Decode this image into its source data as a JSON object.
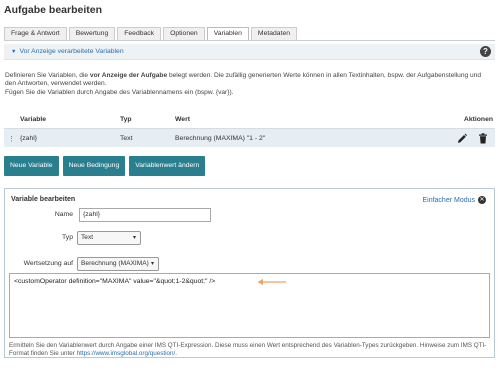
{
  "page": {
    "title": "Aufgabe bearbeiten"
  },
  "tabs": [
    {
      "label": "Frage & Antwort"
    },
    {
      "label": "Bewertung"
    },
    {
      "label": "Feedback"
    },
    {
      "label": "Optionen"
    },
    {
      "label": "Variablen",
      "active": true
    },
    {
      "label": "Metadaten"
    }
  ],
  "info": {
    "toggle_label": "Vor Anzeige verarbeitete Variablen",
    "help_icon": "?"
  },
  "description": {
    "p1_pre": "Definieren Sie Variablen, die ",
    "p1_bold": "vor Anzeige der Aufgabe",
    "p1_post": " belegt werden. Die zufällig generierten Werte können in allen Textinhalten, bspw. der Aufgabenstellung und den Antworten, verwendet werden.",
    "p2": "Fügen Sie die Variablen durch Angabe des Variablennamens ein (bspw. {var})."
  },
  "table": {
    "headers": {
      "variable": "Variable",
      "type": "Typ",
      "value": "Wert",
      "actions": "Aktionen"
    },
    "rows": [
      {
        "handle": "⋮",
        "variable": "{zahl}",
        "type": "Text",
        "value": "Berechnung (MAXIMA) \"1 - 2\""
      }
    ]
  },
  "buttons": {
    "new_variable": "Neue Variable",
    "new_condition": "Neue Bedingung",
    "change_value": "Variablenwert ändern"
  },
  "editor": {
    "title": "Variable bearbeiten",
    "simple_mode": "Einfacher Modus",
    "name_label": "Name",
    "name_value": "{zahl}",
    "type_label": "Typ",
    "type_value": "Text",
    "assign_label": "Wertsetzung auf",
    "assign_value": "Berechnung (MAXIMA)",
    "expression": "<customOperator definition=\"MAXIMA\" value=\"&quot;1-2&quot;\" />",
    "note_pre": "Ermitteln Sie den Variablenwert durch Angabe einer IMS QTI-Expression. Diese muss einen Wert entsprechend des Variablen-Types zurückgeben. Hinweise zum IMS QTI-Format finden Sie unter ",
    "note_link": "https://www.imsglobal.org/question/",
    "note_post": "."
  },
  "colors": {
    "accent": "#2a7f8f",
    "link": "#2a6fae",
    "arrow": "#f0a060"
  }
}
